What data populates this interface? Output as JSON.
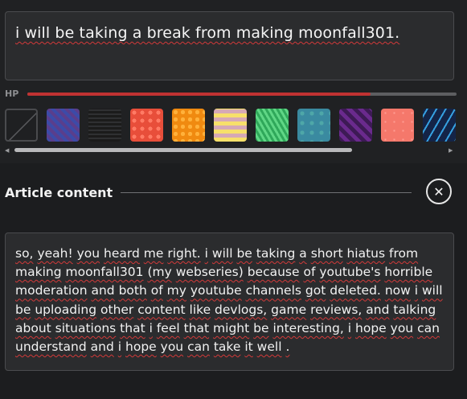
{
  "title_field": {
    "value": "i will be taking a break from making moonfall301."
  },
  "hp": {
    "label": "HP",
    "value": 0.8
  },
  "colors": {
    "hp_fill": "#c03232",
    "spellcheck_underline": "#d23a3a",
    "panel_bg": "#2b2c2e",
    "page_bg": "#202123"
  },
  "pattern_picker": {
    "selected": "none",
    "swatches": [
      {
        "name": "none"
      },
      {
        "name": "blue-purple-pixel"
      },
      {
        "name": "dark-stone"
      },
      {
        "name": "red-scales"
      },
      {
        "name": "orange-honeycomb"
      },
      {
        "name": "yellow-pink-stripes"
      },
      {
        "name": "green-leaves"
      },
      {
        "name": "teal-bubbles"
      },
      {
        "name": "purple-diamonds"
      },
      {
        "name": "salmon-dots"
      },
      {
        "name": "blue-neon"
      }
    ]
  },
  "scrollbar": {
    "left_icon": "triangle-left",
    "right_icon": "triangle-right"
  },
  "article": {
    "section_title": "Article content",
    "close_icon": "close-x",
    "close_glyph": "✕",
    "content": "so, yeah! you heard me right. i will be taking a short hiatus from making moonfall301 (my webseries) because of youtube's horrible moderation and both of my youtube channels got deleted. now i will be uploading other content like devlogs, game reviews, and talking about situations that i feel that might be interesting, i hope you can understand and i hope you can take it well ."
  }
}
